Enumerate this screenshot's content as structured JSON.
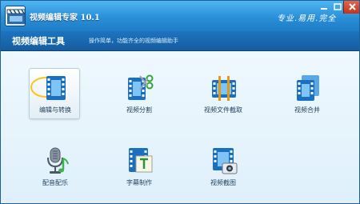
{
  "window": {
    "title": "视频编辑专家 10.1",
    "slogan": "专业.易用.完全"
  },
  "subheader": {
    "title": "视频编辑工具",
    "description": "操作简单，功能齐全的视频编辑助手"
  },
  "tools": [
    {
      "label": "编辑与转换",
      "icon": "film-edit-icon",
      "selected": true
    },
    {
      "label": "视频分割",
      "icon": "film-scissors-icon",
      "selected": false
    },
    {
      "label": "视频文件截取",
      "icon": "film-trim-icon",
      "selected": false
    },
    {
      "label": "视频合并",
      "icon": "film-merge-icon",
      "selected": false
    },
    {
      "label": "配音配乐",
      "icon": "microphone-music-icon",
      "selected": false
    },
    {
      "label": "字幕制作",
      "icon": "film-text-icon",
      "selected": false
    },
    {
      "label": "视频截图",
      "icon": "film-camera-icon",
      "selected": false
    }
  ],
  "colors": {
    "titlebar": "#2a8fd8",
    "subbar": "#1d74bf",
    "background": "#e9f5fc",
    "film": "#1a6fc0",
    "highlight": "#ffc21a"
  }
}
